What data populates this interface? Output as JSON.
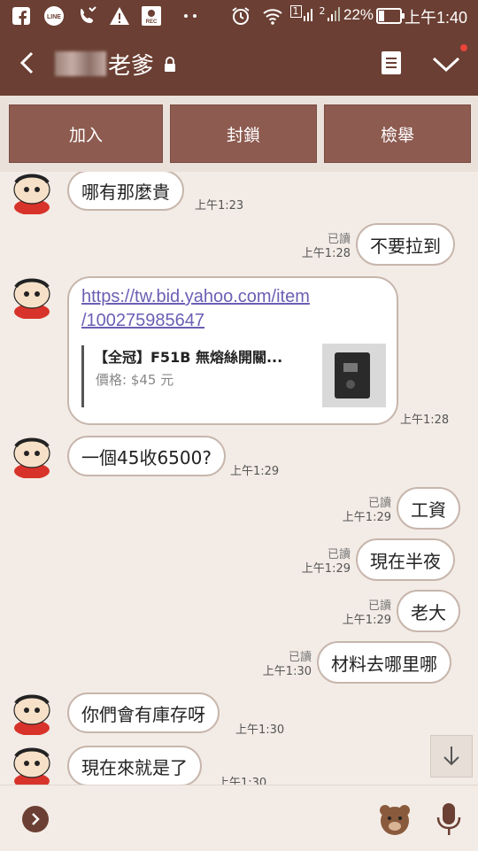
{
  "status_bar": {
    "battery_percent": "22%",
    "time": "上午1:40",
    "sim1": "1",
    "sim2": "2",
    "icons": [
      "facebook-icon",
      "line-icon",
      "missed-call-icon",
      "warning-icon",
      "rec-icon",
      "more-dots-icon",
      "alarm-icon",
      "wifi-icon",
      "signal-icon",
      "battery-icon"
    ]
  },
  "header": {
    "title": "老爹"
  },
  "actions": {
    "join_label": "加入",
    "block_label": "封鎖",
    "report_label": "檢舉"
  },
  "messages": [
    {
      "side": "left",
      "text": "哪有那麼貴",
      "time": "上午1:23"
    },
    {
      "side": "right",
      "text": "不要拉到",
      "read": "已讀",
      "time": "上午1:28"
    },
    {
      "side": "left",
      "link_line1": "https://tw.bid.yahoo.com/item",
      "link_line2": "/100275985647",
      "preview_title": "【全冠】F51B 無熔絲開關...",
      "preview_price": "價格: $45 元",
      "time": "上午1:28"
    },
    {
      "side": "left",
      "text": "一個45收6500?",
      "time": "上午1:29"
    },
    {
      "side": "right",
      "text": "工資",
      "read": "已讀",
      "time": "上午1:29"
    },
    {
      "side": "right",
      "text": "現在半夜",
      "read": "已讀",
      "time": "上午1:29"
    },
    {
      "side": "right",
      "text": "老大",
      "read": "已讀",
      "time": "上午1:29"
    },
    {
      "side": "right",
      "text": "材料去哪里哪",
      "read": "已讀",
      "time": "上午1:30"
    },
    {
      "side": "left",
      "text": "你們會有庫存呀",
      "time": "上午1:30"
    },
    {
      "side": "left",
      "text": "現在來就是了",
      "time": "上午1:30"
    }
  ],
  "colors": {
    "header_bg": "#6b3f33",
    "action_button": "#8d5b50",
    "chat_bg": "#f3ece6",
    "link": "#6a5fb4"
  }
}
